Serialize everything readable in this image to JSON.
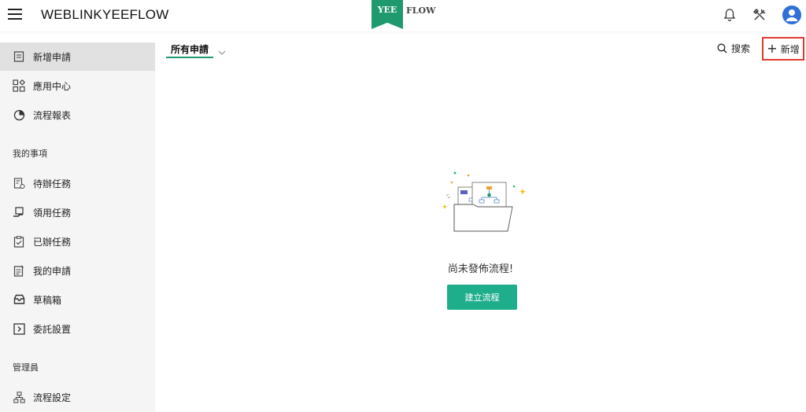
{
  "header": {
    "app_title": "WEBLINKYEEFLOW",
    "logo_left": "YEE",
    "logo_right": "FLOW"
  },
  "sidebar": {
    "items": [
      {
        "label": "新增申請",
        "icon": "form-icon"
      },
      {
        "label": "應用中心",
        "icon": "apps-icon"
      },
      {
        "label": "流程報表",
        "icon": "pie-chart-icon"
      }
    ],
    "section_mine": "我的事項",
    "mine_items": [
      {
        "label": "待辦任務",
        "icon": "todo-icon"
      },
      {
        "label": "領用任務",
        "icon": "claim-icon"
      },
      {
        "label": "已辦任務",
        "icon": "done-icon"
      },
      {
        "label": "我的申請",
        "icon": "my-request-icon"
      },
      {
        "label": "草稿箱",
        "icon": "draft-box-icon"
      },
      {
        "label": "委託設置",
        "icon": "delegate-icon"
      }
    ],
    "section_admin": "管理員",
    "admin_items": [
      {
        "label": "流程設定",
        "icon": "flow-settings-icon"
      }
    ]
  },
  "toolbar": {
    "tab_label": "所有申請",
    "search_label": "搜索",
    "add_label": "新增"
  },
  "empty_state": {
    "message": "尚未發佈流程!",
    "button_label": "建立流程"
  },
  "colors": {
    "brand": "#1f9a6e",
    "button": "#1fae8c",
    "highlight_border": "#e03a2e",
    "avatar": "#2e6fd8"
  }
}
